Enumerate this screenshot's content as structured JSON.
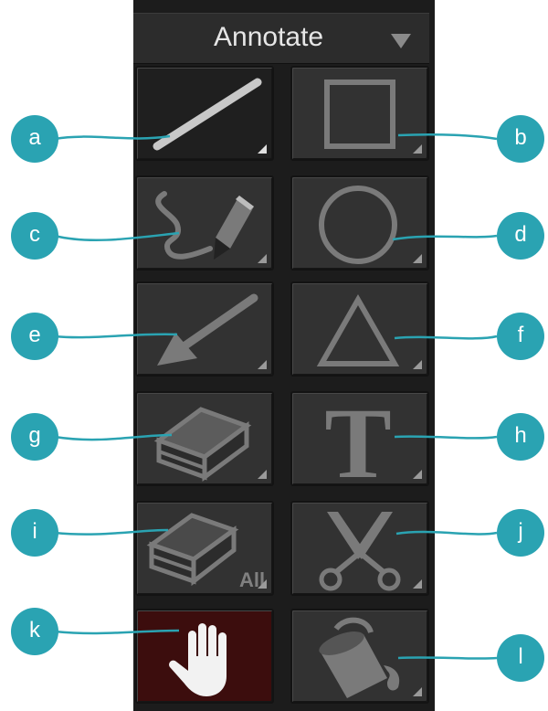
{
  "header": {
    "title": "Annotate",
    "dropdown_icon": "triangle-down-icon"
  },
  "tools": [
    {
      "id": "line",
      "icon": "line-icon",
      "callout": "a",
      "state": "selected"
    },
    {
      "id": "rectangle",
      "icon": "rectangle-icon",
      "callout": "b"
    },
    {
      "id": "freehand",
      "icon": "freehand-pencil-icon",
      "callout": "c"
    },
    {
      "id": "ellipse",
      "icon": "circle-icon",
      "callout": "d"
    },
    {
      "id": "arrow",
      "icon": "arrow-icon",
      "callout": "e"
    },
    {
      "id": "triangle",
      "icon": "triangle-icon",
      "callout": "f"
    },
    {
      "id": "eraser",
      "icon": "eraser-icon",
      "callout": "g"
    },
    {
      "id": "text",
      "icon": "text-t-icon",
      "glyph": "T",
      "callout": "h"
    },
    {
      "id": "erase-all",
      "icon": "eraser-all-icon",
      "label": "All",
      "callout": "i"
    },
    {
      "id": "cut",
      "icon": "scissors-icon",
      "callout": "j"
    },
    {
      "id": "pan",
      "icon": "hand-icon",
      "callout": "k",
      "state": "active"
    },
    {
      "id": "fill",
      "icon": "paint-bucket-icon",
      "callout": "l"
    }
  ],
  "colors": {
    "callout": "#2aa3b2",
    "panel": "#1c1c1c",
    "button": "#323232",
    "active_red": "#3c0d0d"
  }
}
